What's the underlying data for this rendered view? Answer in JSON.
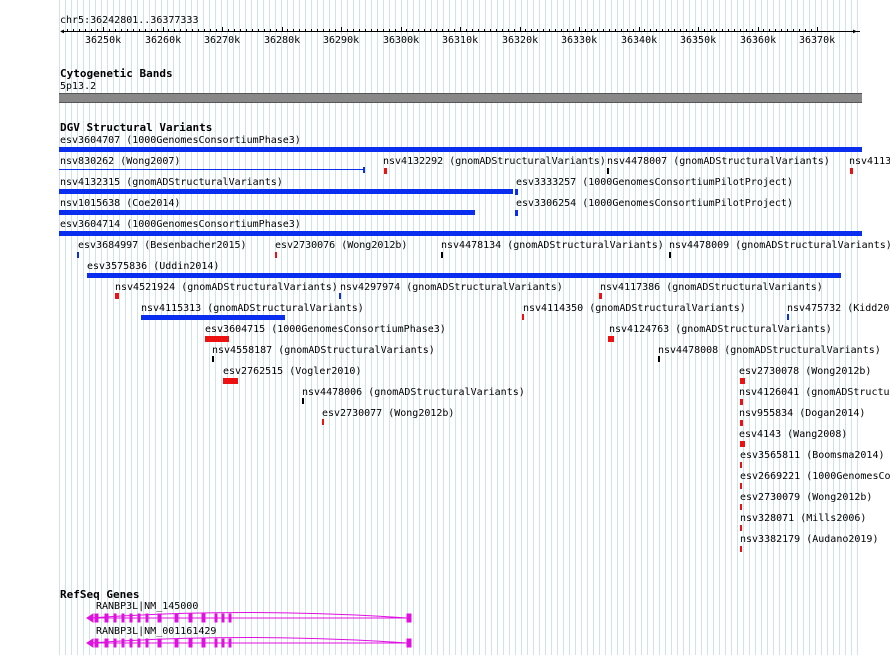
{
  "ruler": {
    "position": "chr5:36242801..36377333",
    "ticks": [
      "36250k",
      "36260k",
      "36270k",
      "36280k",
      "36290k",
      "36300k",
      "36310k",
      "36320k",
      "36330k",
      "36340k",
      "36350k",
      "36360k",
      "36370k"
    ]
  },
  "cytoband": {
    "title": "Cytogenetic Bands",
    "label": "5p13.2"
  },
  "dgv": {
    "title": "DGV Structural Variants",
    "labels": [
      "esv3604707 (1000GenomesConsortiumPhase3)",
      "nsv830262 (Wong2007)",
      "nsv4132292 (gnomADStructuralVariants)",
      "nsv4478007 (gnomADStructuralVariants)",
      "nsv4113",
      "nsv4132315 (gnomADStructuralVariants)",
      "esv3333257 (1000GenomesConsortiumPilotProject)",
      "nsv1015638 (Coe2014)",
      "esv3306254 (1000GenomesConsortiumPilotProject)",
      "esv3604714 (1000GenomesConsortiumPhase3)",
      "esv3684997 (Besenbacher2015)",
      "esv2730076 (Wong2012b)",
      "nsv4478134 (gnomADStructuralVariants)",
      "nsv4478009 (gnomADStructuralVariants)",
      "esv3575836 (Uddin2014)",
      "nsv4521924 (gnomADStructuralVariants)",
      "nsv4297974 (gnomADStructuralVariants)",
      "nsv4117386 (gnomADStructuralVariants)",
      "nsv4115313 (gnomADStructuralVariants)",
      "nsv4114350 (gnomADStructuralVariants)",
      "nsv475732 (Kidd20",
      "esv3604715 (1000GenomesConsortiumPhase3)",
      "nsv4124763 (gnomADStructuralVariants)",
      "nsv4558187 (gnomADStructuralVariants)",
      "nsv4478008 (gnomADStructuralVariants)",
      "esv2762515 (Vogler2010)",
      "esv2730078 (Wong2012b)",
      "nsv4478006 (gnomADStructuralVariants)",
      "nsv4126041 (gnomADStructu",
      "esv2730077 (Wong2012b)",
      "nsv955834 (Dogan2014)",
      "esv4143 (Wang2008)",
      "esv3565811 (Boomsma2014)",
      "esv2669221 (1000GenomesCo",
      "esv2730079 (Wong2012b)",
      "nsv328071 (Mills2006)",
      "nsv3382179 (Audano2019)"
    ]
  },
  "refseq": {
    "title": "RefSeq Genes",
    "genes": [
      "RANBP3L|NM_145000",
      "RANBP3L|NM_001161429"
    ]
  },
  "colors": {
    "grid": "#c5dfe8",
    "blue": "#0a2ef0",
    "red": "#ee1111",
    "magenta": "#e010e0",
    "band": "#888888"
  }
}
